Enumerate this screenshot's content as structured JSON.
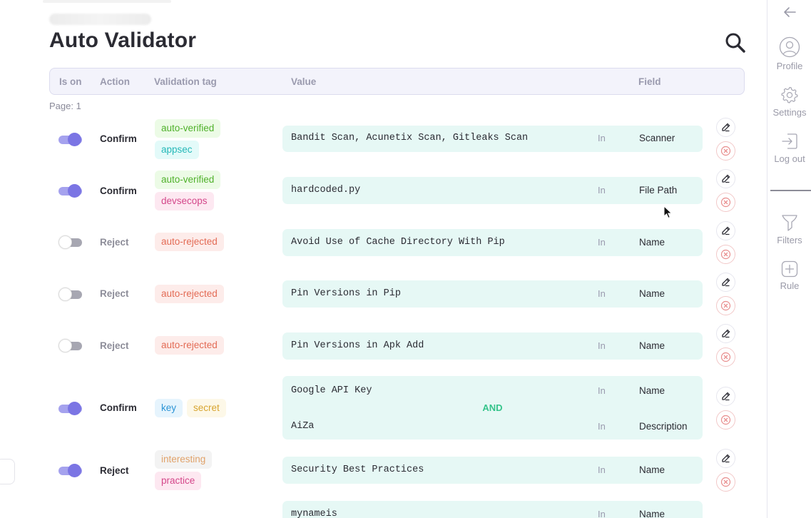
{
  "page": {
    "title": "Auto Validator",
    "page_label": "Page: 1"
  },
  "table": {
    "columns": {
      "is_on": "Is on",
      "action": "Action",
      "tag": "Validation tag",
      "value": "Value",
      "field": "Field"
    }
  },
  "rows": [
    {
      "on": true,
      "action": "Confirm",
      "tags": [
        "auto-verified",
        "appsec"
      ],
      "conditions": [
        {
          "value": "Bandit Scan, Acunetix Scan, Gitleaks Scan",
          "op": "In",
          "field": "Scanner"
        }
      ]
    },
    {
      "on": true,
      "action": "Confirm",
      "tags": [
        "auto-verified",
        "devsecops"
      ],
      "conditions": [
        {
          "value": "hardcoded.py",
          "op": "In",
          "field": "File Path"
        }
      ]
    },
    {
      "on": false,
      "action": "Reject",
      "tags": [
        "auto-rejected"
      ],
      "conditions": [
        {
          "value": "Avoid Use of Cache Directory With Pip",
          "op": "In",
          "field": "Name"
        }
      ]
    },
    {
      "on": false,
      "action": "Reject",
      "tags": [
        "auto-rejected"
      ],
      "conditions": [
        {
          "value": "Pin Versions in Pip",
          "op": "In",
          "field": "Name"
        }
      ]
    },
    {
      "on": false,
      "action": "Reject",
      "tags": [
        "auto-rejected"
      ],
      "conditions": [
        {
          "value": "Pin Versions in Apk Add",
          "op": "In",
          "field": "Name"
        }
      ]
    },
    {
      "on": true,
      "action": "Confirm",
      "tags": [
        "key",
        "secret"
      ],
      "conditions": [
        {
          "value": "Google API Key",
          "op": "In",
          "field": "Name"
        },
        {
          "value": "AiZa",
          "op": "In",
          "field": "Description"
        }
      ],
      "joiner": "AND"
    },
    {
      "on": true,
      "action": "Reject",
      "tags": [
        "interesting",
        "practice"
      ],
      "conditions": [
        {
          "value": "Security Best Practices",
          "op": "In",
          "field": "Name"
        }
      ]
    },
    {
      "conditions": [
        {
          "value": "mynameis",
          "op": "In",
          "field": "Name"
        }
      ]
    }
  ],
  "sidebar": {
    "back_icon": "arrow-left-icon",
    "items": [
      {
        "label": "Profile",
        "icon": "user-icon"
      },
      {
        "label": "Settings",
        "icon": "gear-icon"
      },
      {
        "label": "Log out",
        "icon": "logout-icon"
      },
      {
        "label": "Filters",
        "icon": "filter-icon"
      },
      {
        "label": "Rule",
        "icon": "plus-icon"
      }
    ]
  },
  "colors": {
    "toggle_on": "#7b75e4",
    "value_bg": "#e6f8f5",
    "and_color": "#35c48b",
    "delete": "#e88d8d"
  }
}
